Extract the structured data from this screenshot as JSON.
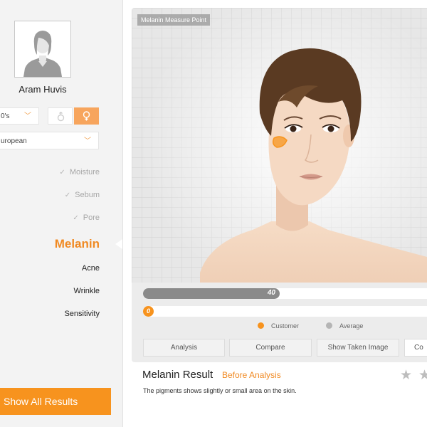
{
  "profile": {
    "name": "Aram Huvis",
    "age_select": "0's",
    "ethnicity_select": "uropean",
    "gender_selected": "female"
  },
  "menu": {
    "completed": [
      {
        "label": "Moisture"
      },
      {
        "label": "Sebum"
      },
      {
        "label": "Pore"
      }
    ],
    "active": "Melanin",
    "pending": [
      {
        "label": "Acne"
      },
      {
        "label": "Wrinkle"
      },
      {
        "label": "Sensitivity"
      }
    ]
  },
  "show_all_button": "Show All Results",
  "viewer": {
    "measure_label": "Melanin Measure Point"
  },
  "bars": {
    "customer_value": "40",
    "customer_fraction": 0.48,
    "average_value": "0"
  },
  "legend": {
    "customer": "Customer",
    "average": "Average"
  },
  "tabs": {
    "analysis": "Analysis",
    "compare": "Compare",
    "show_taken": "Show Taken Image",
    "cont": "Co"
  },
  "result": {
    "title": "Melanin Result",
    "status": "Before Analysis",
    "description": "The pigments shows slightly or small area on the skin."
  },
  "colors": {
    "accent": "#f7931e",
    "customer_dot": "#f7931e",
    "average_dot": "#b5b5b5",
    "customer_bar": "#8a8a8a"
  },
  "icons": {
    "male": "male-icon",
    "female": "female-icon",
    "check": "check-icon",
    "star": "star-icon",
    "chevron": "chevron-down-icon"
  }
}
